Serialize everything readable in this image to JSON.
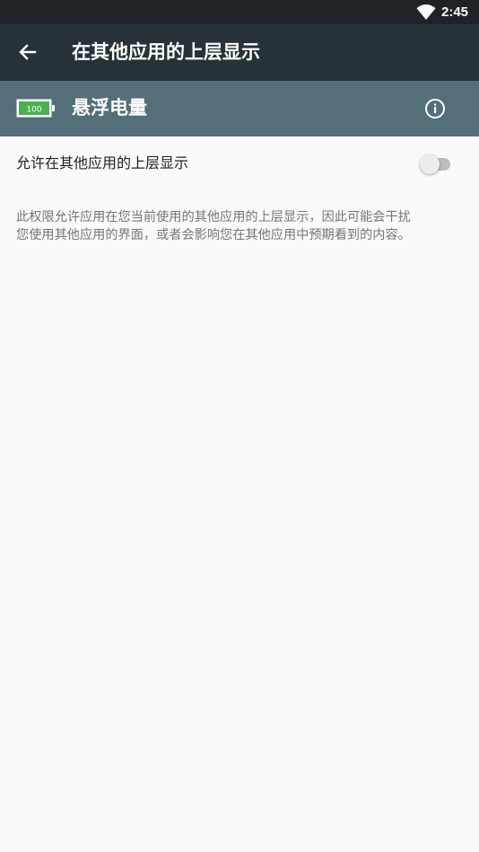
{
  "status_bar": {
    "time": "2:45",
    "icons": [
      "wifi-icon"
    ]
  },
  "app_bar": {
    "back_icon": "arrow-back-icon",
    "title": "在其他应用的上层显示"
  },
  "app_header": {
    "icon": "battery-100-icon",
    "icon_text": "100",
    "app_name": "悬浮电量",
    "info_icon": "info-icon"
  },
  "setting": {
    "label": "允许在其他应用的上层显示",
    "toggle_state": "off"
  },
  "description": {
    "line1": "此权限允许应用在您当前使用的其他应用的上层显示，因此可能会干扰",
    "line2": "您使用其他应用的界面，或者会影响您在其他应用中预期看到的内容。"
  },
  "colors": {
    "status_bar": "#1d2327",
    "app_bar": "#263238",
    "app_header": "#546e7a",
    "background": "#fafafa",
    "battery_green": "#4caf50"
  }
}
